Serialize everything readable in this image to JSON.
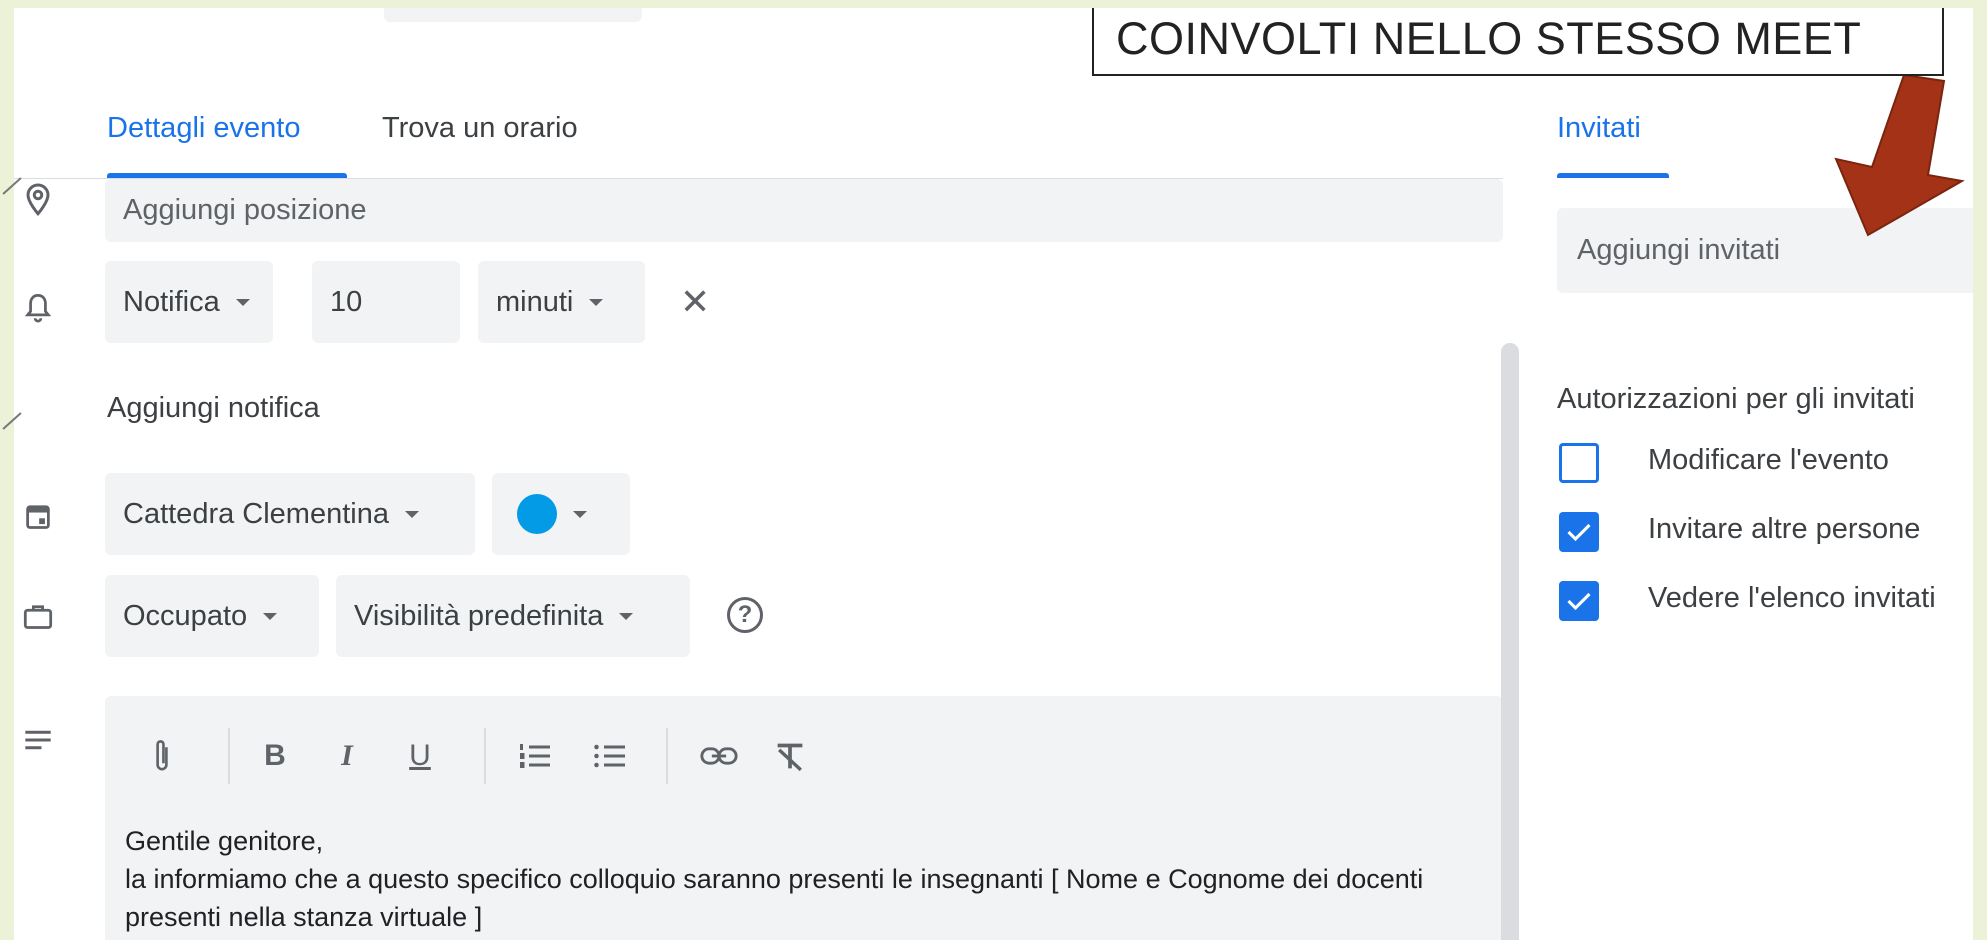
{
  "callout": {
    "text": "COINVOLTI NELLO STESSO MEET"
  },
  "tabs": [
    {
      "label": "Dettagli evento",
      "active": true
    },
    {
      "label": "Trova un orario",
      "active": false
    }
  ],
  "right_tab": {
    "label": "Invitati"
  },
  "location": {
    "placeholder": "Aggiungi posizione",
    "icon": "location-pin-icon"
  },
  "notification": {
    "icon": "bell-icon",
    "type": "Notifica",
    "amount": "10",
    "unit": "minuti",
    "add_label": "Aggiungi notifica"
  },
  "calendar": {
    "icon": "calendar-icon",
    "name": "Cattedra Clementina",
    "color": "#039be5"
  },
  "availability": {
    "icon": "briefcase-icon",
    "status": "Occupato",
    "visibility": "Visibilità predefinita"
  },
  "description": {
    "icon": "notes-icon",
    "toolbar": [
      "attach-icon",
      "bold-icon",
      "italic-icon",
      "underline-icon",
      "numbered-list-icon",
      "bulleted-list-icon",
      "link-icon",
      "clear-format-icon"
    ],
    "text": "Gentile genitore,\nla informiamo che a questo specifico colloquio saranno presenti le insegnanti [ Nome e Cognome dei docenti presenti nella stanza virtuale ]"
  },
  "guests": {
    "placeholder": "Aggiungi invitati",
    "permissions_title": "Autorizzazioni per gli invitati",
    "permissions": [
      {
        "label": "Modificare l'evento",
        "checked": false
      },
      {
        "label": "Invitare altre persone",
        "checked": true
      },
      {
        "label": "Vedere l'elenco invitati",
        "checked": true
      }
    ]
  },
  "colors": {
    "accent": "#1a73e8",
    "arrow": "#a33216",
    "field_bg": "#f1f3f4",
    "slide_bg": "#ecf2d7"
  }
}
